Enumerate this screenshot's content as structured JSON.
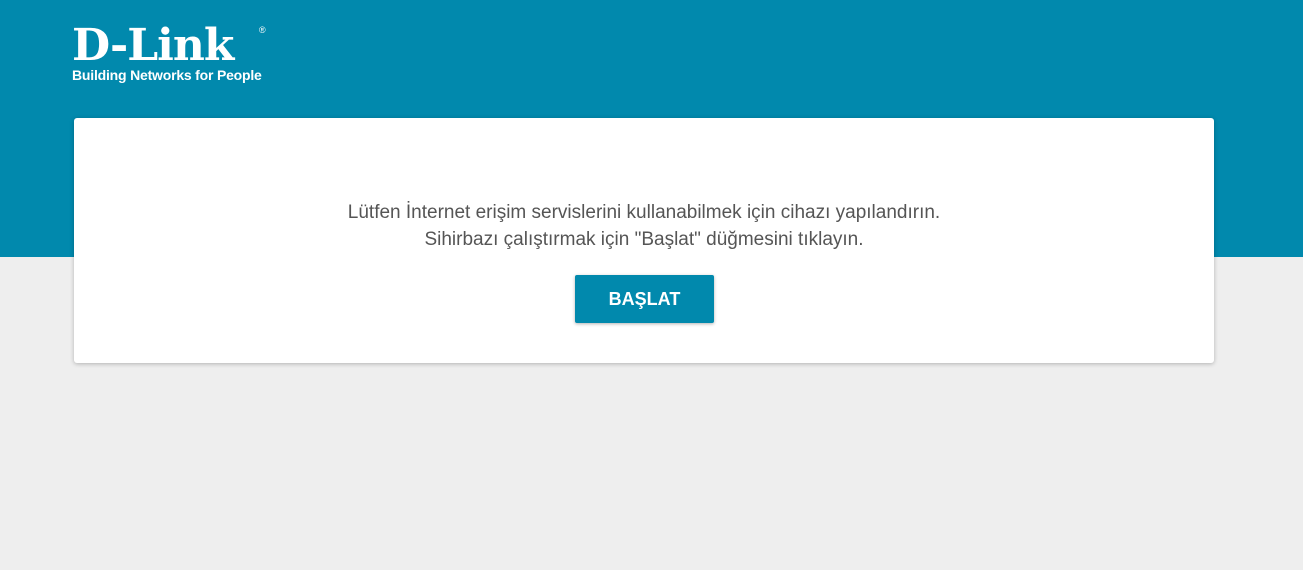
{
  "brand": {
    "name": "D-Link",
    "registered": "®",
    "tagline": "Building Networks for People",
    "color": "#0189ad"
  },
  "wizard": {
    "line1": "Lütfen İnternet erişim servislerini kullanabilmek için cihazı yapılandırın.",
    "line2": "Sihirbazı çalıştırmak için \"Başlat\" düğmesini tıklayın.",
    "start_label": "BAŞLAT"
  },
  "colors": {
    "header_bg": "#0189ad",
    "page_bg": "#eeeeee",
    "card_bg": "#ffffff",
    "text": "#555555"
  }
}
